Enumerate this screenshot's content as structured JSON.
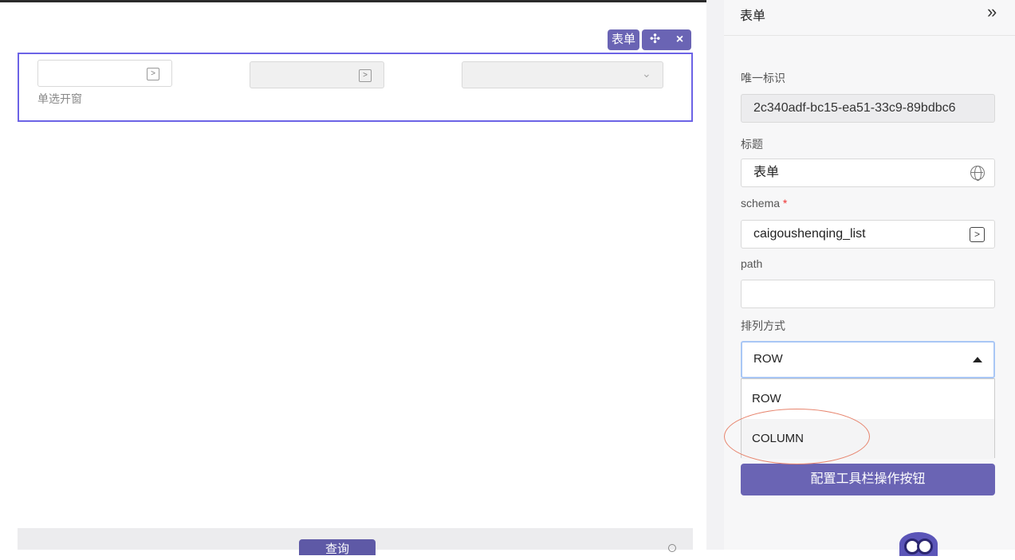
{
  "canvas": {
    "component_tag": "表单",
    "move_icon": "✣",
    "close_icon": "×",
    "field_label": "单选开窗",
    "query_button": "查询"
  },
  "panel": {
    "title": "表单",
    "collapse_icon": "»",
    "fields": {
      "id_label": "唯一标识",
      "id_value": "2c340adf-bc15-ea51-33c9-89bdbc6",
      "title_label": "标题",
      "title_value": "表单",
      "schema_label": "schema",
      "schema_required": "*",
      "schema_value": "caigoushenqing_list",
      "path_label": "path",
      "path_value": "",
      "layout_label": "排列方式",
      "layout_value": "ROW"
    },
    "layout_options": [
      "ROW",
      "COLUMN"
    ],
    "config_button": "配置工具栏操作按钮"
  }
}
